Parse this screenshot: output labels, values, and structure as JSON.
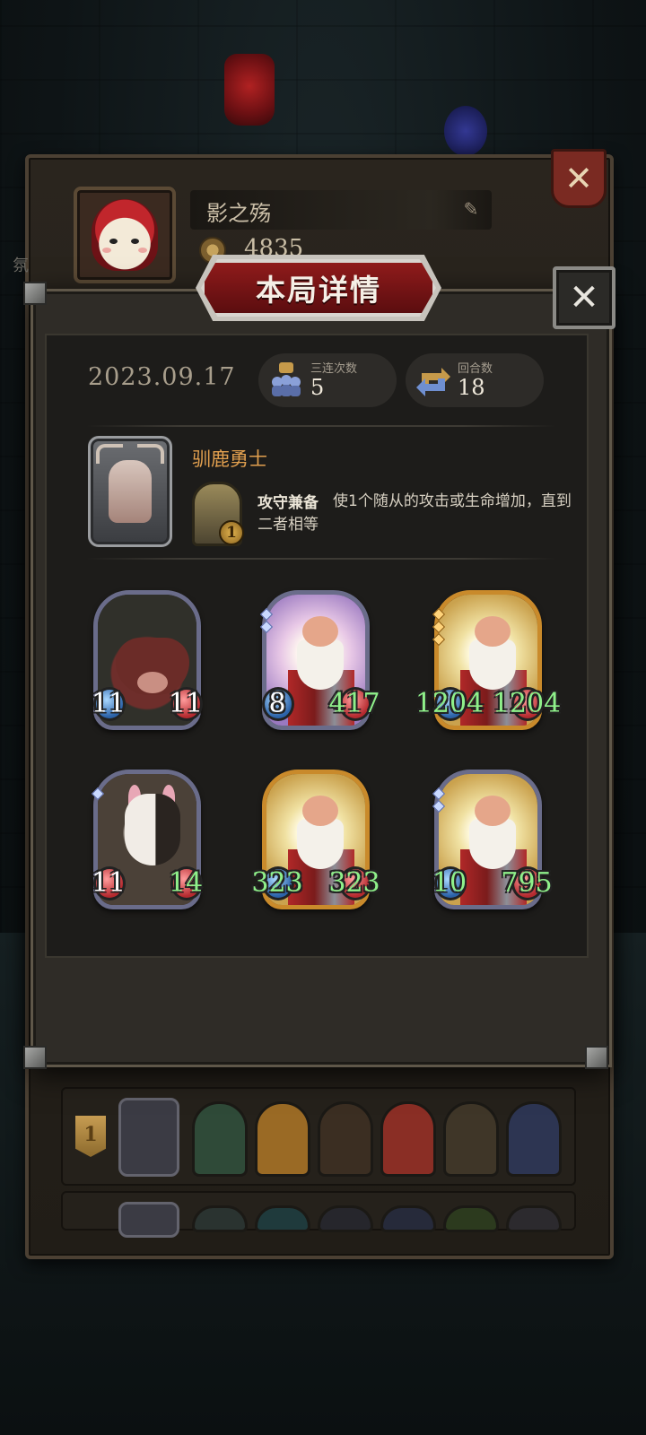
{
  "profile": {
    "name": "影之殇",
    "coins": "4835",
    "side_hint": "氛"
  },
  "detail": {
    "title": "本局详情",
    "date": "2023.09.17",
    "stats": [
      {
        "label": "三连次数",
        "value": "5",
        "icon": "triple-icon"
      },
      {
        "label": "回合数",
        "value": "18",
        "icon": "rounds-icon"
      }
    ],
    "hero": {
      "name": "驯鹿勇士",
      "power_level": "1",
      "power_name": "攻守兼备",
      "power_desc": "使1个随从的攻击或生命增加，直到二者相等"
    },
    "minions": [
      {
        "art": "boar",
        "frame": "normal",
        "gems": 0,
        "attack": "11",
        "health": "11",
        "attack_buffed": false,
        "health_buffed": false
      },
      {
        "art": "dwarf-purple",
        "frame": "normal",
        "gems": 2,
        "attack": "8",
        "health": "417",
        "attack_buffed": false,
        "health_buffed": true
      },
      {
        "art": "dwarf",
        "frame": "gold",
        "gems": 3,
        "attack": "1204",
        "health": "1204",
        "attack_buffed": true,
        "health_buffed": true
      },
      {
        "art": "mask",
        "frame": "normal",
        "gems": 1,
        "attack": "11",
        "health": "14",
        "attack_buffed": false,
        "health_buffed": true
      },
      {
        "art": "dwarf",
        "frame": "gold",
        "gems": 0,
        "attack": "323",
        "health": "323",
        "attack_buffed": true,
        "health_buffed": true
      },
      {
        "art": "dwarf",
        "frame": "normal",
        "gems": 2,
        "attack": "10",
        "health": "795",
        "attack_buffed": true,
        "health_buffed": true
      }
    ]
  },
  "leaderboard": {
    "rows": [
      {
        "rank": "1"
      },
      {
        "rank": ""
      }
    ]
  },
  "colors": {
    "accent_orange": "#e2a04f",
    "buffed_green": "#8ff08a",
    "banner_red": "#8f1b1b"
  }
}
